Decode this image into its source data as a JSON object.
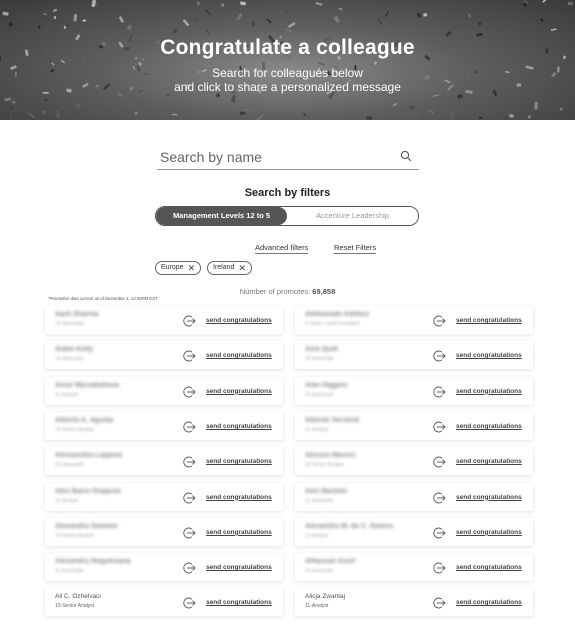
{
  "hero": {
    "title": "Congratulate a colleague",
    "subtitle_line1": "Search for colleagues below",
    "subtitle_line2": "and click to share a personalized message"
  },
  "search": {
    "placeholder": "Search by name",
    "value": ""
  },
  "filters": {
    "title": "Search by filters",
    "toggle": [
      {
        "label": "Management Levels 12 to 5",
        "active": true
      },
      {
        "label": "Accenture Leadership",
        "active": false
      }
    ],
    "advanced_label": "Advanced filters",
    "reset_label": "Reset Filters",
    "chips": [
      {
        "label": "Europe",
        "remove": "✕"
      },
      {
        "label": "Ireland",
        "remove": "✕"
      }
    ]
  },
  "promo_note": "*Promotion data current as of December 1, 12:00PM EST",
  "promotes": {
    "label": "Number of promotes:",
    "count": "69,858"
  },
  "send_label": "send congratulations",
  "colleagues": [
    {
      "name": "Aarti Sharma",
      "role": "10-Associate"
    },
    {
      "name": "Adebowale Adebisi",
      "role": "9-Team Lead/Consultant"
    },
    {
      "name": "Aidan Kelly",
      "role": "10-Associate"
    },
    {
      "name": "Aine Quill",
      "role": "10-Associate"
    },
    {
      "name": "Ainur Myrzabekova",
      "role": "11-Analyst"
    },
    {
      "name": "Alan Higgins",
      "role": "10-Associate"
    },
    {
      "name": "Alberto A. Aguilar",
      "role": "10-Senior Analyst"
    },
    {
      "name": "Alberto Verrienti",
      "role": "11-Analyst"
    },
    {
      "name": "Alessandra Luppino",
      "role": "10-Associate"
    },
    {
      "name": "Alessio Macosi",
      "role": "10-Senior Analyst"
    },
    {
      "name": "Alex Bacci Dragusti",
      "role": "11-Analyst"
    },
    {
      "name": "Alex Bastion",
      "role": "11-Associate"
    },
    {
      "name": "Alexandra Sammer",
      "role": "10-Senior Analyst"
    },
    {
      "name": "Alexandra W. de C. Soares",
      "role": "11-Analyst"
    },
    {
      "name": "Alexandru Negulesana",
      "role": "11-Associate"
    },
    {
      "name": "Alhassan Assif",
      "role": "11-Associate"
    },
    {
      "name": "Ali C. Ozhelvaci",
      "role": "10-Senior Analyst"
    },
    {
      "name": "Alicja Zwantaj",
      "role": "11-Analyst"
    }
  ]
}
